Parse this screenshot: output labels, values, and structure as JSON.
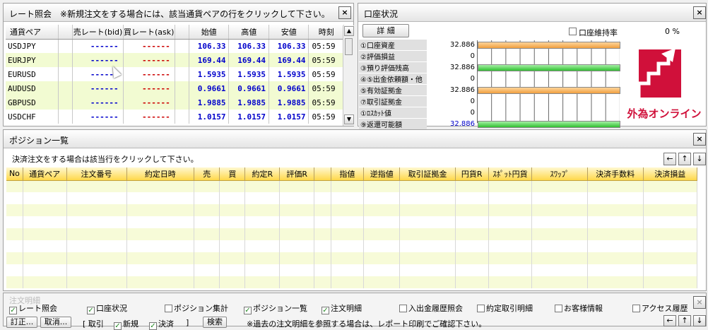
{
  "rate_panel": {
    "title": "レート照会",
    "note": "※新規注文をする場合には、該当通貨ペアの行をクリックして下さい。",
    "close": "×",
    "headers": [
      "通貨ペア",
      "売レート(bid)",
      "買レート(ask)",
      "始値",
      "高値",
      "安値",
      "時刻"
    ],
    "rows": [
      {
        "pair": "USDJPY",
        "bid": "------",
        "ask": "------",
        "open": "106.33",
        "high": "106.33",
        "low": "106.33",
        "time": "05:59"
      },
      {
        "pair": "EURJPY",
        "bid": "------",
        "ask": "------",
        "open": "169.44",
        "high": "169.44",
        "low": "169.44",
        "time": "05:59"
      },
      {
        "pair": "EURUSD",
        "bid": "------",
        "ask": "------",
        "open": "1.5935",
        "high": "1.5935",
        "low": "1.5935",
        "time": "05:59"
      },
      {
        "pair": "AUDUSD",
        "bid": "------",
        "ask": "------",
        "open": "0.9661",
        "high": "0.9661",
        "low": "0.9661",
        "time": "05:59"
      },
      {
        "pair": "GBPUSD",
        "bid": "------",
        "ask": "------",
        "open": "1.9885",
        "high": "1.9885",
        "low": "1.9885",
        "time": "05:59"
      },
      {
        "pair": "USDCHF",
        "bid": "------",
        "ask": "------",
        "open": "1.0157",
        "high": "1.0157",
        "low": "1.0157",
        "time": "05:59"
      }
    ]
  },
  "account_panel": {
    "title": "口座状況",
    "close": "×",
    "detail_button": "詳 細",
    "maintenance_label": "口座維持率",
    "maintenance_value": "0 %",
    "items": [
      {
        "label": "①口座資産",
        "value": "32.886",
        "bar": "orange"
      },
      {
        "label": "②評価損益",
        "value": "0",
        "bar": ""
      },
      {
        "label": "③預り評価残高",
        "value": "32.886",
        "bar": "green"
      },
      {
        "label": "④⑤出金依頼額・他",
        "value": "0",
        "bar": ""
      },
      {
        "label": "⑤有効証拠金",
        "value": "32.886",
        "bar": "orange"
      },
      {
        "label": "⑦取引証拠金",
        "value": "0",
        "bar": ""
      },
      {
        "label": "①ﾛｽｶｯﾄ値",
        "value": "0",
        "bar": ""
      },
      {
        "label": "⑨返還可能額",
        "value": "32.886",
        "bar": "green"
      }
    ],
    "logo_text": "外為オンライン",
    "colors": {
      "logo": "#d0103a"
    }
  },
  "position_panel": {
    "title": "ポジション一覧",
    "close": "×",
    "note": "決済注文をする場合は該当行をクリックして下さい。",
    "nav": [
      "←",
      "↑",
      "↓"
    ],
    "headers": [
      "No",
      "通貨ペア",
      "注文番号",
      "約定日時",
      "売",
      "買",
      "約定R",
      "評価R",
      "",
      "指値",
      "逆指値",
      "取引証拠金",
      "円貨R",
      "ｽﾎﾟｯﾄ円貨",
      "ｽﾜｯﾌﾟ",
      "決済手数料",
      "決済損益"
    ]
  },
  "bottom": {
    "title_partial": "注文明細",
    "close": "×",
    "checkboxes": [
      {
        "label": "レート照会",
        "checked": true
      },
      {
        "label": "口座状況",
        "checked": true
      },
      {
        "label": "ポジション集計",
        "checked": false
      },
      {
        "label": "ポジション一覧",
        "checked": true
      },
      {
        "label": "注文明細",
        "checked": true
      },
      {
        "label": "入出金履歴照会",
        "checked": false
      },
      {
        "label": "約定取引明細",
        "checked": false
      },
      {
        "label": "お客様情報",
        "checked": false
      },
      {
        "label": "アクセス履歴",
        "checked": false
      }
    ],
    "buttons": {
      "correct": "訂正...",
      "cancel": "取消...",
      "search": "検索"
    },
    "filter_open": "[ 取引",
    "filter_new": "新規",
    "filter_settle": "決済",
    "filter_close": "]",
    "note": "※過去の注文明細を参照する場合は、レポート印刷でご確認下さい。",
    "nav": [
      "←",
      "↑",
      "↓"
    ]
  }
}
